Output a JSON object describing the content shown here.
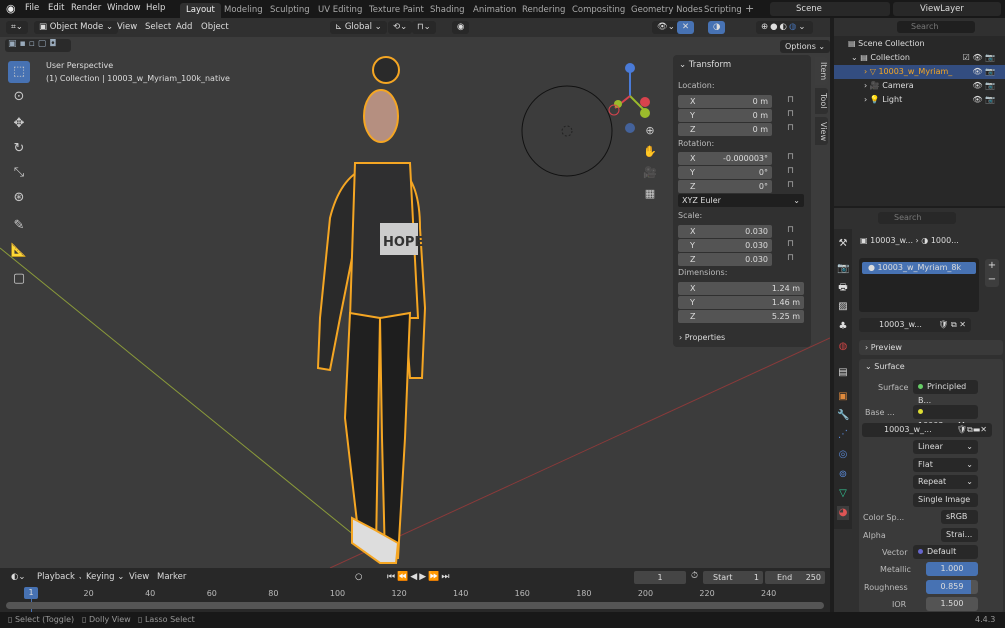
{
  "menu": [
    "File",
    "Edit",
    "Render",
    "Window",
    "Help"
  ],
  "workspaces": [
    "Layout",
    "Modeling",
    "Sculpting",
    "UV Editing",
    "Texture Paint",
    "Shading",
    "Animation",
    "Rendering",
    "Compositing",
    "Geometry Nodes",
    "Scripting"
  ],
  "scene": "Scene",
  "view_layer": "ViewLayer",
  "viewport": {
    "mode": "Object Mode",
    "menus": [
      "View",
      "Select",
      "Add",
      "Object"
    ],
    "orientation": "Global",
    "options": "Options",
    "perspective": "User Perspective",
    "collection_info": "(1) Collection | 10003_w_Myriam_100k_native",
    "shirt_text": "HOPE",
    "selection_color": "#f5a623"
  },
  "npanel": {
    "tabs": [
      "Item",
      "Tool",
      "View"
    ],
    "title": "Transform",
    "location_label": "Location:",
    "location": [
      [
        "X",
        "0 m"
      ],
      [
        "Y",
        "0 m"
      ],
      [
        "Z",
        "0 m"
      ]
    ],
    "rotation_label": "Rotation:",
    "rotation": [
      [
        "X",
        "-0.000003°"
      ],
      [
        "Y",
        "0°"
      ],
      [
        "Z",
        "0°"
      ]
    ],
    "rotation_mode": "XYZ Euler",
    "scale_label": "Scale:",
    "scale": [
      [
        "X",
        "0.030"
      ],
      [
        "Y",
        "0.030"
      ],
      [
        "Z",
        "0.030"
      ]
    ],
    "dimensions_label": "Dimensions:",
    "dimensions": [
      [
        "X",
        "1.24 m"
      ],
      [
        "Y",
        "1.46 m"
      ],
      [
        "Z",
        "5.25 m"
      ]
    ],
    "properties": "Properties"
  },
  "outliner": {
    "search_placeholder": "Search",
    "items": [
      "Scene Collection",
      "Collection",
      "10003_w_Myriam_",
      "Camera",
      "Light"
    ]
  },
  "properties": {
    "search_placeholder": "Search",
    "breadcrumb": [
      "10003_w...",
      "1000..."
    ],
    "material_slot": "10003_w_Myriam_8k",
    "material_name": "10003_w...",
    "preview": "Preview",
    "surface_header": "Surface",
    "surface_label": "Surface",
    "surface_value": "Principled B...",
    "base_label": "Base ...",
    "base_value": "10003_w_M...",
    "image_name": "10003_w_...",
    "interpolation": "Linear",
    "projection": "Flat",
    "extension": "Repeat",
    "source": "Single Image",
    "color_space_label": "Color Sp...",
    "color_space": "sRGB",
    "alpha_label": "Alpha",
    "alpha": "Strai...",
    "vector_label": "Vector",
    "vector": "Default",
    "metallic_label": "Metallic",
    "metallic": "1.000",
    "metallic_fill": 1.0,
    "roughness_label": "Roughness",
    "roughness": "0.859",
    "roughness_fill": 0.859,
    "ior_label": "IOR",
    "ior": "1.500"
  },
  "timeline": {
    "menus": [
      "Playback",
      "Keying",
      "View",
      "Marker"
    ],
    "current_frame": "1",
    "start_label": "Start",
    "start": "1",
    "end_label": "End",
    "end": "250",
    "ticks": [
      "20",
      "40",
      "60",
      "80",
      "100",
      "120",
      "140",
      "160",
      "180",
      "200",
      "220",
      "240"
    ]
  },
  "status": {
    "items": [
      "Select (Toggle)",
      "Dolly View",
      "Lasso Select"
    ],
    "version": "4.4.3"
  },
  "accent": "#4772b3"
}
